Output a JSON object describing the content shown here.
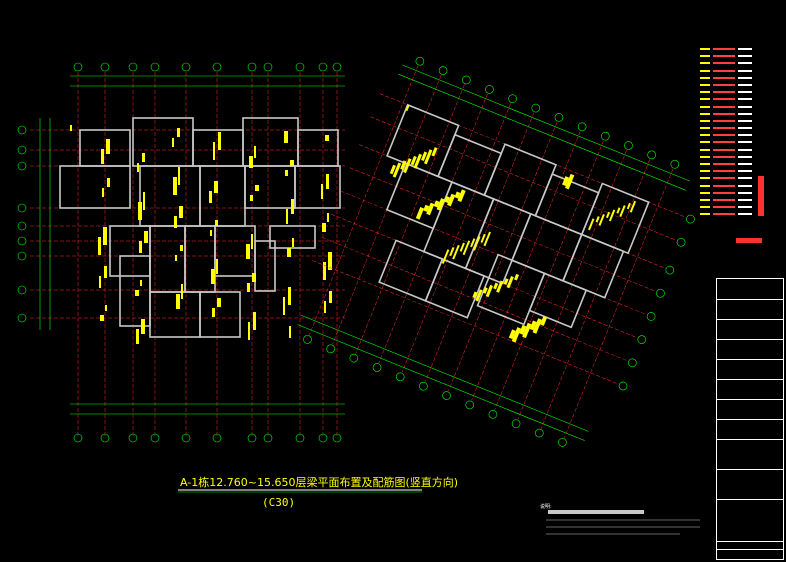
{
  "drawing": {
    "title": "A-1栋12.760~15.650层梁平面布置及配筋图(竖直方向)",
    "subtitle": "(C30)",
    "notes_label": "说明:"
  },
  "colors": {
    "background": "#000000",
    "axis": "#ff2a2a",
    "dimension": "#00ff00",
    "beam": "#c8c8c8",
    "annotation": "#ffff00",
    "frame": "#ffffff",
    "bubble": "#00ff00"
  }
}
